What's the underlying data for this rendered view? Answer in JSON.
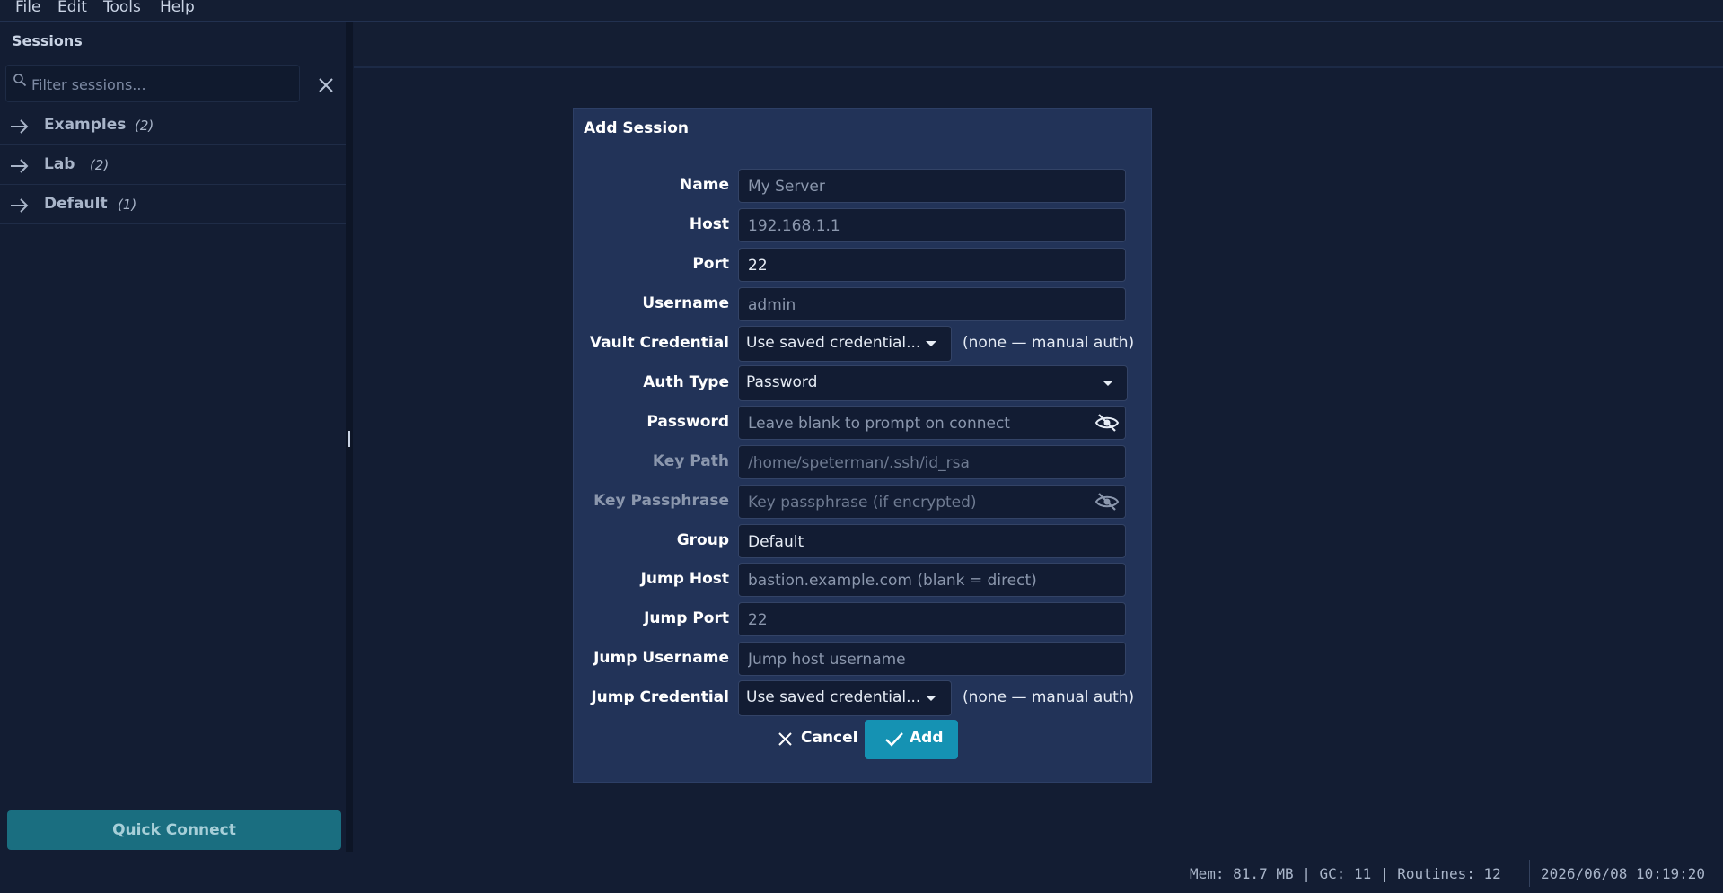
{
  "menu": [
    "File",
    "Edit",
    "Tools",
    "Help"
  ],
  "sidebar": {
    "title": "Sessions",
    "search_placeholder": "Filter sessions...",
    "groups": [
      {
        "label": "Examples",
        "count": "(2)"
      },
      {
        "label": "Lab",
        "count": "(2)"
      },
      {
        "label": "Default",
        "count": "(1)"
      }
    ],
    "quick_connect": "Quick Connect"
  },
  "dialog": {
    "title": "Add Session",
    "fields": {
      "name": {
        "label": "Name",
        "placeholder": "My Server",
        "value": ""
      },
      "host": {
        "label": "Host",
        "placeholder": "192.168.1.1",
        "value": ""
      },
      "port": {
        "label": "Port",
        "value": "22"
      },
      "username": {
        "label": "Username",
        "placeholder": "admin",
        "value": ""
      },
      "vault_credential": {
        "label": "Vault Credential",
        "selected": "Use saved credential...",
        "note": "(none — manual auth)"
      },
      "auth_type": {
        "label": "Auth Type",
        "selected": "Password"
      },
      "password": {
        "label": "Password",
        "placeholder": "Leave blank to prompt on connect",
        "value": ""
      },
      "key_path": {
        "label": "Key Path",
        "placeholder": "/home/speterman/.ssh/id_rsa",
        "value": ""
      },
      "key_passphrase": {
        "label": "Key Passphrase",
        "placeholder": "Key passphrase (if encrypted)",
        "value": ""
      },
      "group": {
        "label": "Group",
        "value": "Default"
      },
      "jump_host": {
        "label": "Jump Host",
        "placeholder": "bastion.example.com (blank = direct)",
        "value": ""
      },
      "jump_port": {
        "label": "Jump Port",
        "placeholder": "22",
        "value": ""
      },
      "jump_username": {
        "label": "Jump Username",
        "placeholder": "Jump host username",
        "value": ""
      },
      "jump_credential": {
        "label": "Jump Credential",
        "selected": "Use saved credential...",
        "note": "(none — manual auth)"
      }
    },
    "cancel_label": "Cancel",
    "add_label": "Add"
  },
  "status": {
    "metrics": "Mem: 81.7 MB | GC: 11 | Routines: 12",
    "datetime": "2026/06/08 10:19:20"
  },
  "colors": {
    "background": "#131d33",
    "dialog": "#223358",
    "accent": "#1592b3",
    "quick_connect": "#1a6e80"
  }
}
